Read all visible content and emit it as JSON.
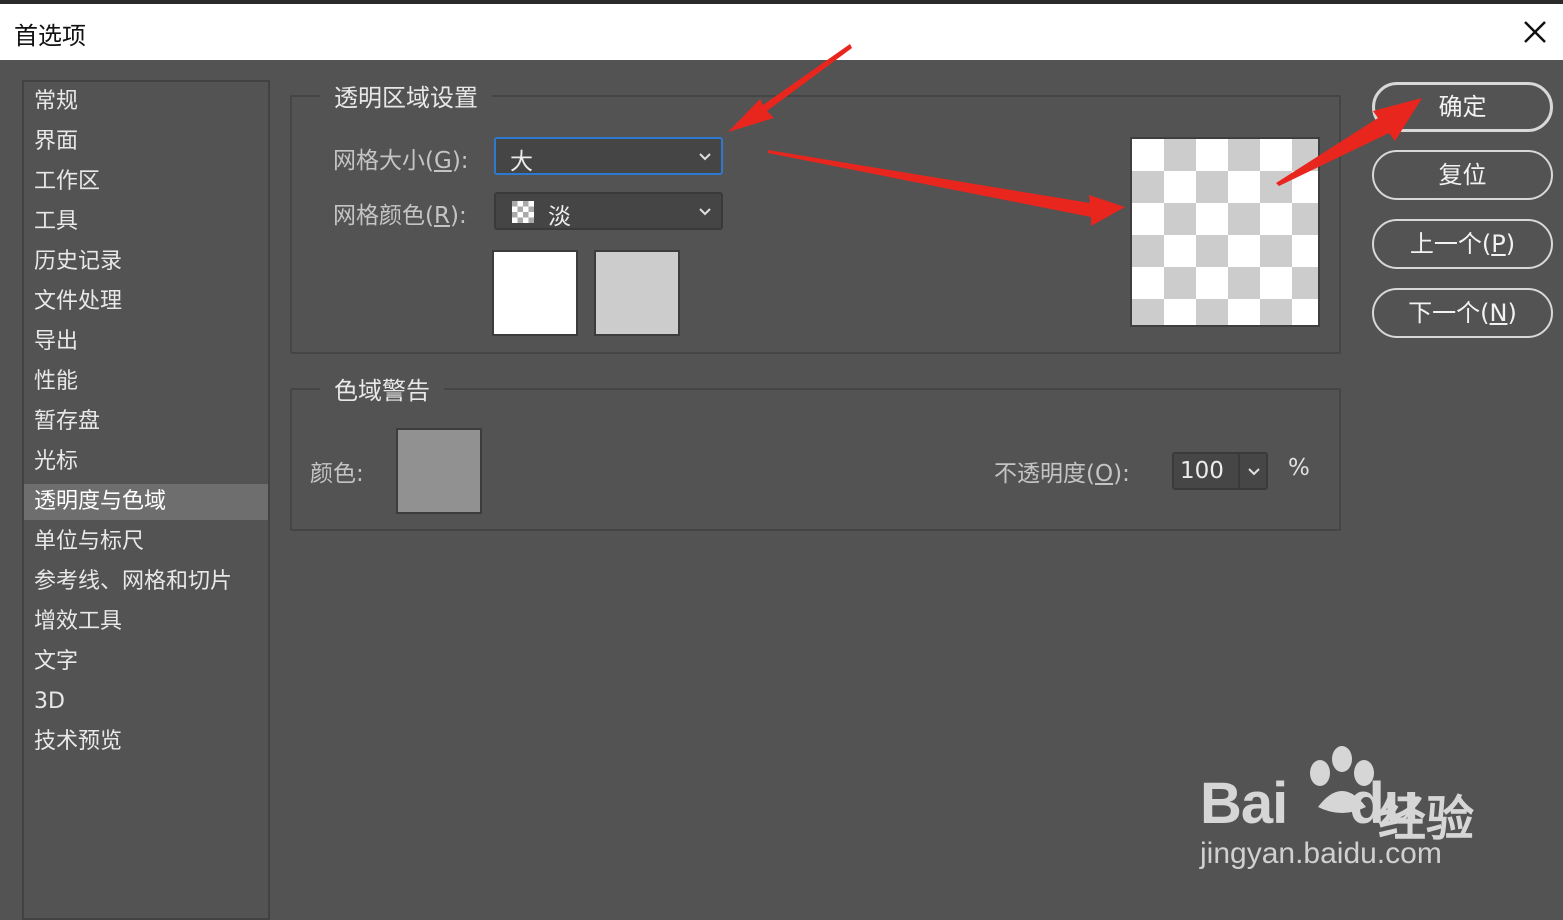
{
  "window": {
    "title": "首选项"
  },
  "sidebar": {
    "items": [
      {
        "label": "常规"
      },
      {
        "label": "界面"
      },
      {
        "label": "工作区"
      },
      {
        "label": "工具"
      },
      {
        "label": "历史记录"
      },
      {
        "label": "文件处理"
      },
      {
        "label": "导出"
      },
      {
        "label": "性能"
      },
      {
        "label": "暂存盘"
      },
      {
        "label": "光标"
      },
      {
        "label": "透明度与色域",
        "active": true
      },
      {
        "label": "单位与标尺"
      },
      {
        "label": "参考线、网格和切片"
      },
      {
        "label": "增效工具"
      },
      {
        "label": "文字"
      },
      {
        "label": "3D"
      },
      {
        "label": "技术预览"
      }
    ]
  },
  "transparency": {
    "legend": "透明区域设置",
    "grid_size": {
      "label": "网格大小",
      "key": "G",
      "value": "大"
    },
    "grid_color": {
      "label": "网格颜色",
      "key": "R",
      "value": "淡"
    },
    "swatch_colors": [
      "#ffffff",
      "#cccccc"
    ]
  },
  "gamut": {
    "legend": "色域警告",
    "color_label": "颜色:",
    "swatch_color": "#919191",
    "opacity": {
      "label": "不透明度",
      "key": "O",
      "value": "100",
      "unit": "%"
    }
  },
  "buttons": {
    "ok": "确定",
    "reset": "复位",
    "prev": {
      "label": "上一个",
      "key": "P"
    },
    "next": {
      "label": "下一个",
      "key": "N"
    }
  },
  "watermark": {
    "brand_left": "Bai",
    "brand_right": "du",
    "jingyan": "经验",
    "url": "jingyan.baidu.com"
  },
  "colors": {
    "accent": "#2f78d0",
    "arrow": "#e8261e",
    "panel_bg": "#535353"
  }
}
